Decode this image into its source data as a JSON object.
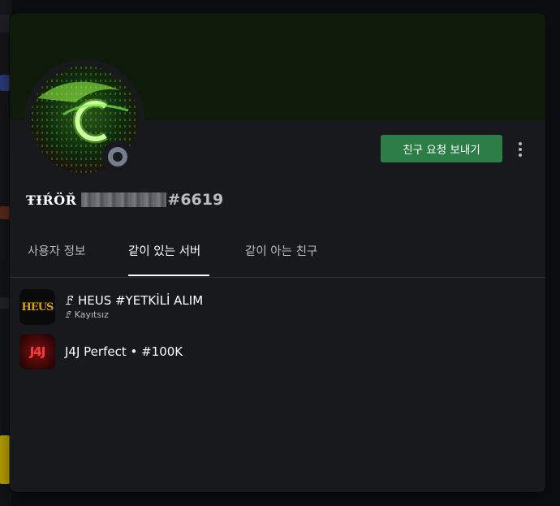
{
  "profile": {
    "username": "ŦƗŔÖŘ",
    "discriminator": "#6619",
    "add_friend_label": "친구 요청 보내기",
    "status": "offline"
  },
  "tabs": [
    {
      "label": "사용자 정보",
      "active": false
    },
    {
      "label": "같이 있는 서버",
      "active": true
    },
    {
      "label": "같이 아는 친구",
      "active": false
    }
  ],
  "servers": [
    {
      "name": "ꗓ HEUS #YETKİLİ ALIM",
      "nickname": "ꗓ Kayıtsız",
      "icon_text": "HEUS"
    },
    {
      "name": "J4J Perfect • #100K",
      "nickname": "",
      "icon_text": "J4J"
    }
  ],
  "colors": {
    "banner": "#0e1a0a",
    "add_friend_button": "#2d7d46",
    "modal_bg": "#18191c",
    "status_offline": "#747f8d"
  },
  "icons": [
    "more-vertical-icon",
    "status-offline-icon",
    "avatar-image"
  ]
}
